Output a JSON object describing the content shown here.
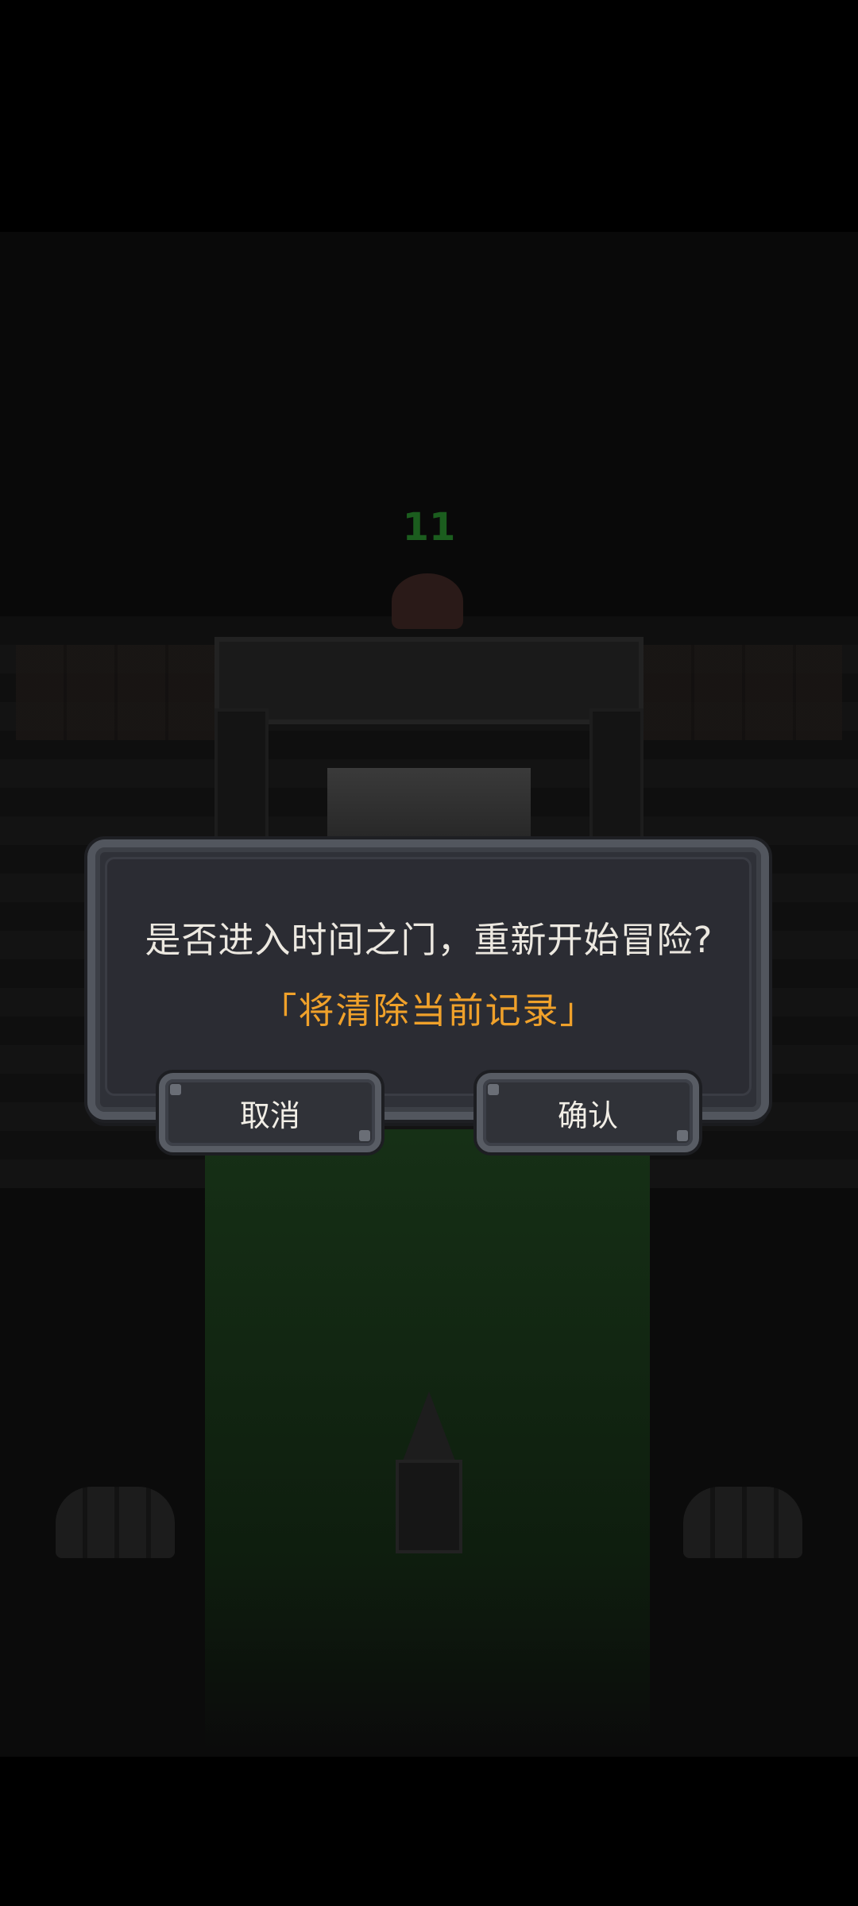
{
  "scene": {
    "level_number": "11"
  },
  "dialog": {
    "message": "是否进入时间之门，重新开始冒险?",
    "warning": "「将清除当前记录」",
    "cancel_label": "取消",
    "confirm_label": "确认"
  },
  "colors": {
    "warning_text": "#f0a12a",
    "message_text": "#ece8e0",
    "dialog_bg": "#2f3138",
    "dialog_border": "#52565e"
  }
}
